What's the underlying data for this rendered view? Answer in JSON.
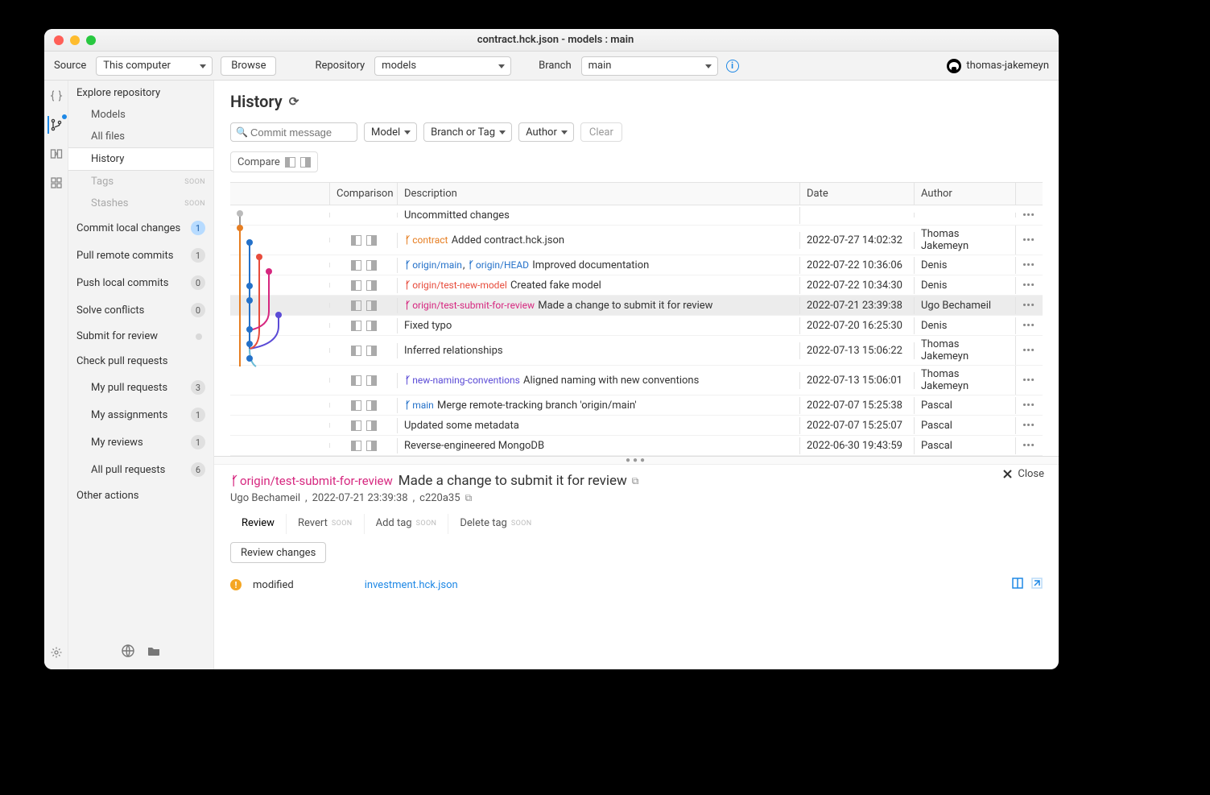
{
  "titlebar": "contract.hck.json - models : main",
  "toolbar": {
    "source_label": "Source",
    "source_value": "This computer",
    "browse": "Browse",
    "repo_label": "Repository",
    "repo_value": "models",
    "branch_label": "Branch",
    "branch_value": "main",
    "username": "thomas-jakemeyn"
  },
  "sidebar": {
    "explore": {
      "title": "Explore repository",
      "models": "Models",
      "all_files": "All files",
      "history": "History",
      "tags": "Tags",
      "stashes": "Stashes",
      "soon": "SOON"
    },
    "commit_local": "Commit local changes",
    "commit_local_badge": "1",
    "pull_remote": "Pull remote commits",
    "pull_remote_badge": "1",
    "push_local": "Push local commits",
    "push_local_badge": "0",
    "solve_conflicts": "Solve conflicts",
    "solve_conflicts_badge": "0",
    "submit_review": "Submit for review",
    "check_pr": "Check pull requests",
    "my_pr": "My pull requests",
    "my_pr_badge": "3",
    "my_assign": "My assignments",
    "my_assign_badge": "1",
    "my_reviews": "My reviews",
    "my_reviews_badge": "1",
    "all_pr": "All pull requests",
    "all_pr_badge": "6",
    "other": "Other actions"
  },
  "history": {
    "header": "History",
    "search_placeholder": "Commit message",
    "filter_model": "Model",
    "filter_branchtag": "Branch or Tag",
    "filter_author": "Author",
    "clear": "Clear",
    "compare": "Compare",
    "col_comparison": "Comparison",
    "col_description": "Description",
    "col_date": "Date",
    "col_author": "Author",
    "rows": [
      {
        "branches": [],
        "desc": "Uncommitted changes",
        "date": "",
        "author": "",
        "no_comp": true
      },
      {
        "branches": [
          {
            "name": "contract",
            "color": "orange"
          }
        ],
        "desc": "Added contract.hck.json",
        "date": "2022-07-27 14:02:32",
        "author": "Thomas Jakemeyn"
      },
      {
        "branches": [
          {
            "name": "origin/main",
            "color": "blue"
          },
          {
            "name": "origin/HEAD",
            "color": "blue"
          }
        ],
        "desc": "Improved documentation",
        "date": "2022-07-22 10:36:06",
        "author": "Denis"
      },
      {
        "branches": [
          {
            "name": "origin/test-new-model",
            "color": "teal"
          }
        ],
        "desc": "Created fake model",
        "date": "2022-07-22 10:34:30",
        "author": "Denis"
      },
      {
        "branches": [
          {
            "name": "origin/test-submit-for-review",
            "color": "pink"
          }
        ],
        "desc": "Made a change to submit it for review",
        "date": "2022-07-21 23:39:38",
        "author": "Ugo Bechameil",
        "selected": true
      },
      {
        "branches": [],
        "desc": "Fixed typo",
        "date": "2022-07-20 16:25:30",
        "author": "Denis"
      },
      {
        "branches": [],
        "desc": "Inferred relationships",
        "date": "2022-07-13 15:06:22",
        "author": "Thomas Jakemeyn"
      },
      {
        "branches": [
          {
            "name": "new-naming-conventions",
            "color": "indigo"
          }
        ],
        "desc": "Aligned naming with new conventions",
        "date": "2022-07-13 15:06:01",
        "author": "Thomas Jakemeyn"
      },
      {
        "branches": [
          {
            "name": "main",
            "color": "blue"
          }
        ],
        "desc": "Merge remote-tracking branch 'origin/main'",
        "date": "2022-07-07 15:25:38",
        "author": "Pascal"
      },
      {
        "branches": [],
        "desc": "Updated some metadata",
        "date": "2022-07-07 15:25:07",
        "author": "Pascal"
      },
      {
        "branches": [],
        "desc": "Reverse-engineered MongoDB",
        "date": "2022-06-30 19:43:59",
        "author": "Pascal"
      }
    ]
  },
  "detail": {
    "branch": "origin/test-submit-for-review",
    "title": "Made a change to submit it for review",
    "close": "Close",
    "author": "Ugo Bechameil",
    "date": "2022-07-21 23:39:38",
    "sha": "c220a35",
    "tabs": {
      "review": "Review",
      "revert": "Revert",
      "addtag": "Add tag",
      "deltag": "Delete tag",
      "soon": "SOON"
    },
    "review_changes": "Review changes",
    "file_status": "modified",
    "file_name": "investment.hck.json"
  }
}
